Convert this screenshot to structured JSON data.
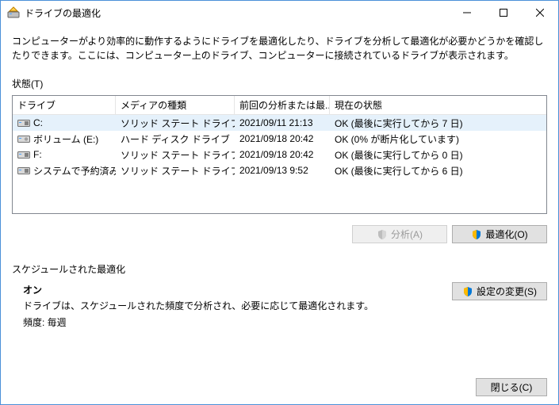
{
  "window": {
    "title": "ドライブの最適化"
  },
  "description": "コンピューターがより効率的に動作するようにドライブを最適化したり、ドライブを分析して最適化が必要かどうかを確認したりできます。ここには、コンピューター上のドライブ、コンピューターに接続されているドライブが表示されます。",
  "status_label": "状態(T)",
  "columns": {
    "drive": "ドライブ",
    "media": "メディアの種類",
    "last": "前回の分析または最...",
    "status": "現在の状態"
  },
  "rows": [
    {
      "drive": "C:",
      "media": "ソリッド ステート ドライブ",
      "last": "2021/09/11 21:13",
      "status": "OK (最後に実行してから 7 日)",
      "icon": "ssd",
      "selected": true
    },
    {
      "drive": "ボリューム (E:)",
      "media": "ハード ディスク ドライブ",
      "last": "2021/09/18 20:42",
      "status": "OK (0% が断片化しています)",
      "icon": "hdd",
      "selected": false
    },
    {
      "drive": "F:",
      "media": "ソリッド ステート ドライブ",
      "last": "2021/09/18 20:42",
      "status": "OK (最後に実行してから 0 日)",
      "icon": "ssd",
      "selected": false
    },
    {
      "drive": "システムで予約済み",
      "media": "ソリッド ステート ドライブ",
      "last": "2021/09/13 9:52",
      "status": "OK (最後に実行してから 6 日)",
      "icon": "ssd",
      "selected": false
    }
  ],
  "buttons": {
    "analyze": "分析(A)",
    "optimize": "最適化(O)",
    "change_settings": "設定の変更(S)",
    "close": "閉じる(C)"
  },
  "schedule": {
    "label": "スケジュールされた最適化",
    "on": "オン",
    "desc": "ドライブは、スケジュールされた頻度で分析され、必要に応じて最適化されます。",
    "freq": "頻度: 毎週"
  }
}
